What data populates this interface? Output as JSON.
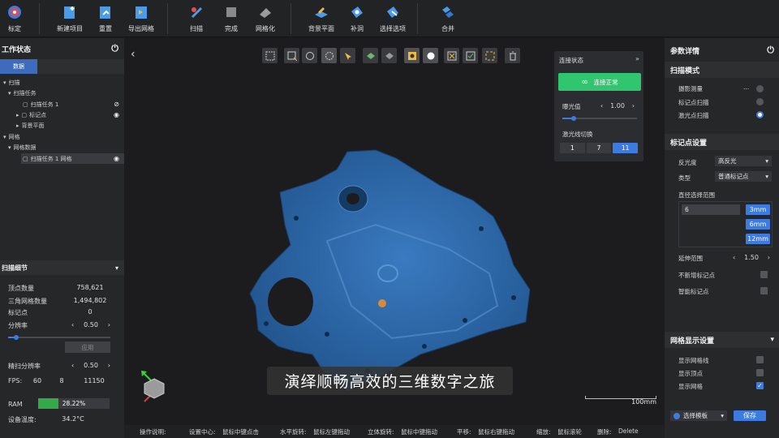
{
  "toolbar": {
    "calibrate": "标定",
    "new_project": "新建项目",
    "reset": "重置",
    "export_mesh": "导出网格",
    "scan": "扫描",
    "finish": "完成",
    "mesh": "网格化",
    "bg_plane": "背景平面",
    "fill_hole": "补洞",
    "select_items": "选择选项",
    "merge": "合并"
  },
  "left": {
    "title": "工作状态",
    "tab": "数据",
    "tree": {
      "scan": "扫描",
      "scan_task": "扫描任务",
      "scan_task_1": "扫描任务 1",
      "markers": "标记点",
      "bg_plane": "背景平面",
      "mesh": "网格",
      "mesh_data": "网格数据",
      "mesh_item": "扫描任务 1 网格"
    },
    "details_title": "扫描细节",
    "vertex_label": "顶点数量",
    "vertex_value": "758,621",
    "triangle_label": "三角网格数量",
    "triangle_value": "1,494,802",
    "marker_label": "标记点",
    "marker_value": "0",
    "resolution_label": "分辨率",
    "resolution_value": "0.50",
    "resolution_slider": 0.08,
    "apply_button": "应用",
    "fine_label": "精扫分辨率",
    "fine_value": "0.50",
    "fps_label": "FPS:",
    "fps_a": "60",
    "fps_b": "8",
    "fps_c": "11150",
    "ram_label": "RAM",
    "ram_value": "28.22%",
    "ram_fraction": 0.2822,
    "temp_label": "设备温度:",
    "temp_value": "34.2°C"
  },
  "conn": {
    "title": "连接状态",
    "button": "连接正常",
    "exposure_label": "曝光值",
    "exposure_value": "1.00",
    "exposure_slider": 0.15,
    "laser_label": "激光线切换",
    "laser_options": [
      "1",
      "7",
      "11"
    ],
    "laser_selected": "11"
  },
  "right": {
    "title": "参数详情",
    "scan_mode_title": "扫描模式",
    "mode_photo": "摄影测量",
    "mode_photo_extra": "...",
    "mode_marker": "标记点扫描",
    "mode_laser": "激光点扫描",
    "marker_settings_title": "标记点设置",
    "reflect_label": "反光度",
    "reflect_value": "高反光",
    "type_label": "类型",
    "type_value": "普通标记点",
    "diameter_label": "直径选择范围",
    "diameter_value": "6",
    "diameter_options": [
      "3mm",
      "6mm",
      "12mm"
    ],
    "extend_label": "延伸范围",
    "extend_value": "1.50",
    "no_new_label": "不新增标记点",
    "smart_label": "智能标记点",
    "mesh_display_title": "网格显示设置",
    "show_lines": "显示网格线",
    "show_vertices": "显示顶点",
    "show_mesh": "显示网格",
    "template_label": "选择模板",
    "save_button": "保存"
  },
  "viewport": {
    "scale_label": "100mm",
    "subtitle": "演绎顺畅高效的三维数字之旅",
    "mesh_color": "#2d6aa8"
  },
  "status": {
    "ops": "操作说明:",
    "center": "设置中心:",
    "center_v": "鼠标中键点击",
    "hrot": "水平旋转:",
    "hrot_v": "鼠标左键拖动",
    "srot": "立体旋转:",
    "srot_v": "鼠标中键拖动",
    "pan": "平移:",
    "pan_v": "鼠标右键拖动",
    "zoom": "缩放:",
    "zoom_v": "鼠标滚轮",
    "del": "删除:",
    "del_v": "Delete"
  }
}
